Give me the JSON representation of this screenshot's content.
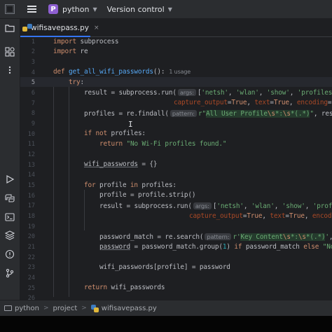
{
  "titlebar": {
    "project_badge": "P",
    "project_name": "python",
    "vcs_label": "Version control",
    "chevron": "⌄"
  },
  "tab": {
    "label": "wifisavepass.py",
    "close": "×"
  },
  "icons": {
    "folder": "folder-icon",
    "structure": "structure-icon",
    "more": "more-icon",
    "run": "run-icon",
    "python_packages": "python-packages-icon",
    "terminal": "terminal-icon",
    "layers": "layers-icon",
    "problems": "problems-icon",
    "git": "git-icon"
  },
  "gutter": [
    "1",
    "2",
    "3",
    "4",
    "5",
    "6",
    "7",
    "8",
    "9",
    "10",
    "11",
    "12",
    "13",
    "14",
    "15",
    "16",
    "17",
    "18",
    "19",
    "20",
    "21",
    "22",
    "23",
    "24",
    "25",
    "26"
  ],
  "code": {
    "l1_kw": "import",
    "l1_rest": " subprocess",
    "l2_kw": "import",
    "l2_rest": " re",
    "l4_kw": "def",
    "l4_fn": "get_all_wifi_passwords",
    "l4_rest": "():",
    "l4_usages": "1 usage",
    "l5_kw": "try",
    "l5_rest": ":",
    "l6_a": "result = subprocess.run(",
    "l6_hint": "args:",
    "l6_b": "[",
    "l6_s1": "'netsh'",
    "l6_c": ", ",
    "l6_s2": "'wlan'",
    "l6_d": ", ",
    "l6_s3": "'show'",
    "l6_e": ", ",
    "l6_s4": "'profiles'",
    "l6_f": "]",
    "l7_p1": "capture_output",
    "l7_a": "=",
    "l7_k1": "True",
    "l7_b": ", ",
    "l7_p2": "text",
    "l7_c": "=",
    "l7_k2": "True",
    "l7_d": ", ",
    "l7_p3": "encoding",
    "l7_e": "=",
    "l8_a": "profiles = re.findall(",
    "l8_hint": "pattern:",
    "l8_r": "r\"",
    "l8_s1": "All User Profile",
    "l8_e1": "\\s",
    "l8_s2": "*:",
    "l8_e2": "\\s",
    "l8_s3": "*(.",
    "l8_s4": "*)",
    "l8_q": "\"",
    "l8_b": ", resul",
    "l10_kw1": "if",
    "l10_kw2": "not",
    "l10_rest": " profiles:",
    "l11_kw": "return",
    "l11_str": "\"No Wi-Fi profiles found.\"",
    "l13_a": "wifi_passwords",
    "l13_b": " = {}",
    "l15_kw1": "for",
    "l15_a": " profile ",
    "l15_kw2": "in",
    "l15_b": " profiles:",
    "l16": "profile = profile.strip()",
    "l17_a": "result = subprocess.run(",
    "l17_hint": "args:",
    "l17_b": "[",
    "l17_s1": "'netsh'",
    "l17_c": ", ",
    "l17_s2": "'wlan'",
    "l17_d": ", ",
    "l17_s3": "'show'",
    "l17_e": ", ",
    "l17_s4": "'profil",
    "l18_p1": "capture_output",
    "l18_a": "=",
    "l18_k1": "True",
    "l18_b": ", ",
    "l18_p2": "text",
    "l18_c": "=",
    "l18_k2": "True",
    "l18_d": ", ",
    "l18_p3": "encoding",
    "l18_e": "=",
    "l20_a": "password_match = re.search(",
    "l20_hint": "pattern:",
    "l20_r": "r'",
    "l20_s1": "Key Content",
    "l20_e1": "\\s",
    "l20_s2": "*:",
    "l20_e2": "\\s",
    "l20_s3": "*(.",
    "l20_s4": "*)",
    "l20_q": "'",
    "l20_b": ", r",
    "l21_a": "password",
    "l21_b": " = password_match.group(",
    "l21_n": "1",
    "l21_c": ") ",
    "l21_kw1": "if",
    "l21_d": " password_match ",
    "l21_kw2": "else",
    "l21_s": " \"No ",
    "l23": "wifi_passwords[profile] = password",
    "l25_kw": "return",
    "l25_rest": " wifi_passwords"
  },
  "statusbar": {
    "project": "python",
    "sep1": ">",
    "folder": "project",
    "sep2": ">",
    "file": "wifisavepass.py"
  },
  "colors": {
    "keyword": "#cf8e6d",
    "function": "#56a8f5",
    "string": "#6aab73",
    "number": "#2aacb8",
    "parameter": "#aa4926",
    "accent": "#3574f0",
    "project_badge": "#8e5fd1"
  }
}
